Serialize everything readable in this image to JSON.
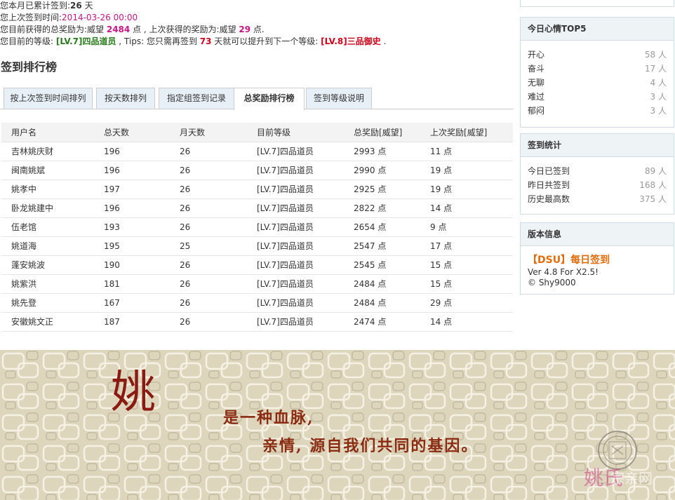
{
  "summary": {
    "line1_label": "您本月已累计签到:",
    "line1_value": "26",
    "line1_suffix": " 天",
    "line2_label": "您上次签到时间:",
    "line2_value": "2014-03-26 00:00",
    "line3_label": "您目前获得的总奖励为:威望 ",
    "line3_value": "2484",
    "line3_mid": " 点 , 上次获得的奖励为:威望 ",
    "line3_value2": "29",
    "line3_suffix": " 点.",
    "line4_label": "您目前的等级: ",
    "line4_level": "[LV.7]四品道员",
    "line4_mid": " , Tips: 您只需再签到 ",
    "line4_days": "73",
    "line4_mid2": " 天就可以提升到下一个等级: ",
    "line4_next": "[LV.8]三品御史",
    "line4_suffix": " ."
  },
  "ranking": {
    "title": "签到排行榜",
    "tabs": [
      {
        "label": "按上次签到时间排列",
        "active": false
      },
      {
        "label": "按天数排列",
        "active": false
      },
      {
        "label": "指定组签到记录",
        "active": false
      },
      {
        "label": "总奖励排行榜",
        "active": true
      },
      {
        "label": "签到等级说明",
        "active": false
      }
    ],
    "columns": [
      "用户名",
      "总天数",
      "月天数",
      "目前等级",
      "总奖励[威望]",
      "上次奖励[威望]"
    ],
    "rows": [
      [
        "吉林姚庆财",
        "196",
        "26",
        "[LV.7]四品道员",
        "2993 点",
        "11 点"
      ],
      [
        "闽南姚斌",
        "196",
        "26",
        "[LV.7]四品道员",
        "2990 点",
        "19 点"
      ],
      [
        "姚孝中",
        "197",
        "26",
        "[LV.7]四品道员",
        "2925 点",
        "19 点"
      ],
      [
        "卧龙姚建中",
        "196",
        "26",
        "[LV.7]四品道员",
        "2822 点",
        "14 点"
      ],
      [
        "伍老馆",
        "193",
        "26",
        "[LV.7]四品道员",
        "2654 点",
        "9 点"
      ],
      [
        "姚道海",
        "195",
        "25",
        "[LV.7]四品道员",
        "2547 点",
        "17 点"
      ],
      [
        "蓬安姚波",
        "190",
        "26",
        "[LV.7]四品道员",
        "2545 点",
        "15 点"
      ],
      [
        "姚紫洪",
        "181",
        "26",
        "[LV.7]四品道员",
        "2484 点",
        "15 点"
      ],
      [
        "姚先登",
        "167",
        "26",
        "[LV.7]四品道员",
        "2484 点",
        "29 点"
      ],
      [
        "安徽姚文正",
        "187",
        "26",
        "[LV.7]四品道员",
        "2474 点",
        "14 点"
      ]
    ]
  },
  "sidebar": {
    "mood": {
      "title": "今日心情TOP5",
      "items": [
        {
          "label": "开心",
          "value": "58 人"
        },
        {
          "label": "奋斗",
          "value": "17 人"
        },
        {
          "label": "无聊",
          "value": "4 人"
        },
        {
          "label": "难过",
          "value": "3 人"
        },
        {
          "label": "郁闷",
          "value": "3 人"
        }
      ]
    },
    "stats": {
      "title": "签到统计",
      "items": [
        {
          "label": "今日已签到",
          "value": "89 人"
        },
        {
          "label": "昨日共签到",
          "value": "168 人"
        },
        {
          "label": "历史最高数",
          "value": "375 人"
        }
      ]
    },
    "version": {
      "title": "版本信息",
      "product": "【DSU】每日签到",
      "version_line": "Ver 4.8 For X2.5!",
      "copyright": "© Shy9000"
    }
  },
  "banner": {
    "big_char": "姚",
    "line1": "是一种血脉,",
    "line2": "亲情, 源自我们共同的基因。",
    "watermark_main": "姚氏",
    "watermark_sub": "宗亲网"
  },
  "colors": {
    "accent_pink": "#c71585",
    "level_green": "#2a7d1d",
    "next_level_red": "#d0021b",
    "dsu_orange": "#e36c09",
    "banner_bg": "#ddd6bd",
    "banner_text": "#8b2b12"
  }
}
